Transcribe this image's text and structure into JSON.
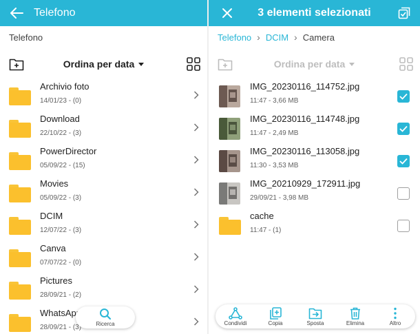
{
  "colors": {
    "accent": "#29b6d6",
    "folder": "#fbc02d"
  },
  "left": {
    "title": "Telefono",
    "back_icon": "arrow-left-icon",
    "path": "Telefono",
    "sort_label": "Ordina per data",
    "folders": [
      {
        "name": "Archivio foto",
        "meta": "14/01/23 - (0)"
      },
      {
        "name": "Download",
        "meta": "22/10/22 - (3)"
      },
      {
        "name": "PowerDirector",
        "meta": "05/09/22 - (15)"
      },
      {
        "name": "Movies",
        "meta": "05/09/22 - (3)"
      },
      {
        "name": "DCIM",
        "meta": "12/07/22 - (3)"
      },
      {
        "name": "Canva",
        "meta": "07/07/22 - (0)"
      },
      {
        "name": "Pictures",
        "meta": "28/09/21 - (2)"
      },
      {
        "name": "WhatsApp",
        "meta": "28/09/21 - (3)"
      }
    ],
    "search_label": "Ricerca"
  },
  "right": {
    "title": "3 elementi selezionati",
    "close_icon": "close-icon",
    "select_all_icon": "select-all-icon",
    "breadcrumb": [
      "Telefono",
      "DCIM",
      "Camera"
    ],
    "sort_label": "Ordina per data",
    "items": [
      {
        "name": "IMG_20230116_114752.jpg",
        "meta": "11:47 - 3,66 MB",
        "checked": true,
        "kind": "image"
      },
      {
        "name": "IMG_20230116_114748.jpg",
        "meta": "11:47 - 2,49 MB",
        "checked": true,
        "kind": "image"
      },
      {
        "name": "IMG_20230116_113058.jpg",
        "meta": "11:30 - 3,53 MB",
        "checked": true,
        "kind": "image"
      },
      {
        "name": "IMG_20210929_172911.jpg",
        "meta": "29/09/21 - 3,98 MB",
        "checked": false,
        "kind": "image"
      },
      {
        "name": "cache",
        "meta": "11:47 - (1)",
        "checked": false,
        "kind": "folder"
      }
    ],
    "actions": [
      {
        "label": "Condividi",
        "icon": "share-icon"
      },
      {
        "label": "Copia",
        "icon": "copy-icon"
      },
      {
        "label": "Sposta",
        "icon": "move-icon"
      },
      {
        "label": "Elimina",
        "icon": "delete-icon"
      },
      {
        "label": "Altro",
        "icon": "more-icon"
      }
    ]
  }
}
